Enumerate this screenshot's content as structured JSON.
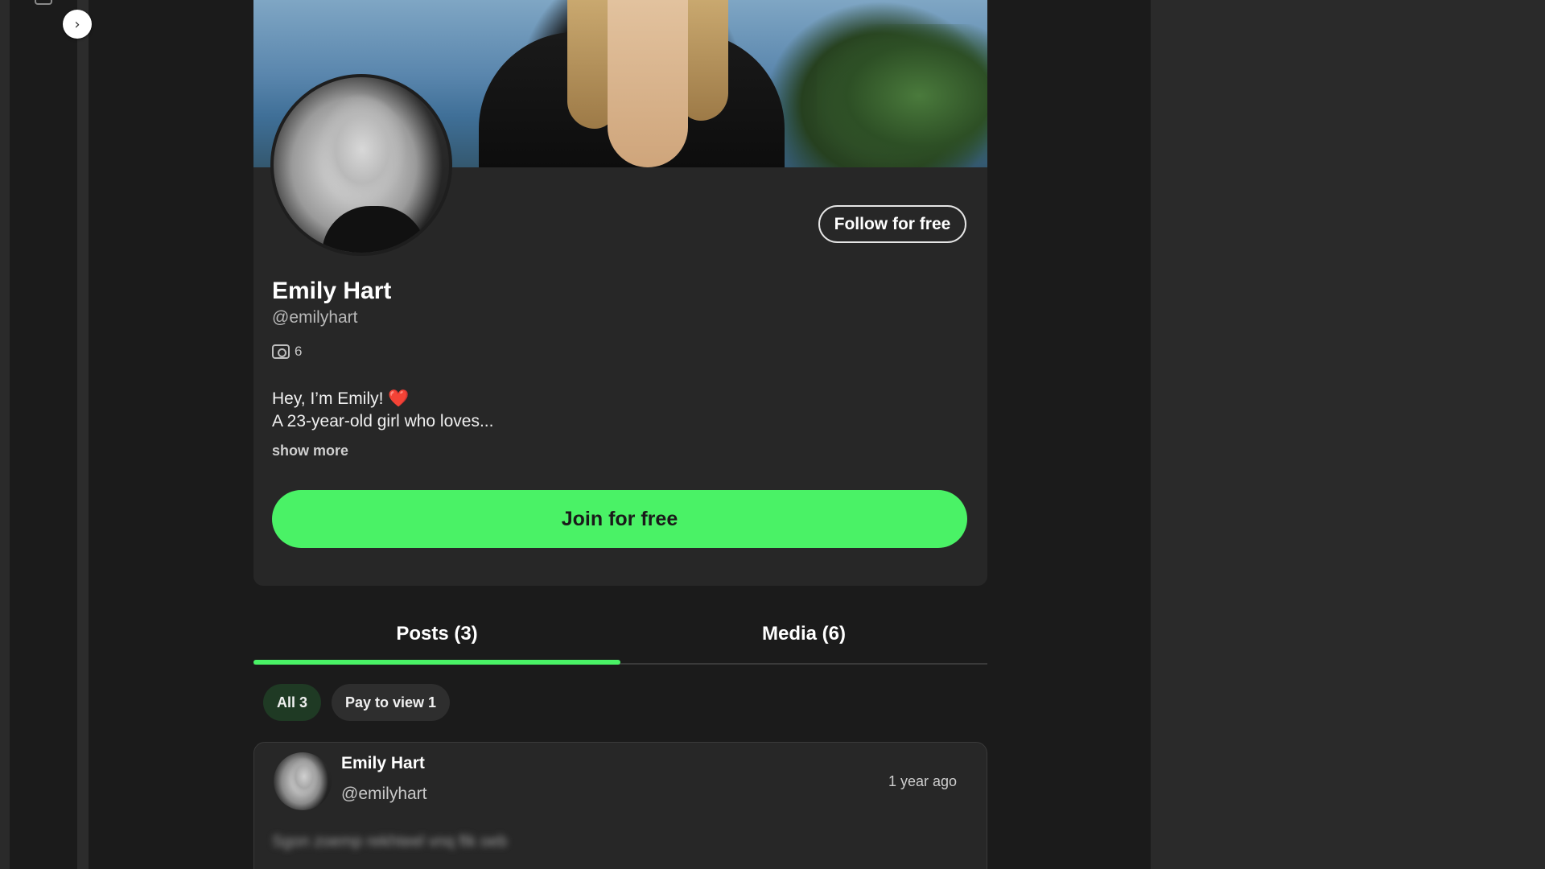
{
  "sidebar": {
    "collapse_icon": "chevron-right-icon",
    "collapse_glyph": "›"
  },
  "profile": {
    "follow_label": "Follow for free",
    "name": "Emily Hart",
    "handle": "@emilyhart",
    "media_count": "6",
    "media_icon": "camera-icon",
    "bio_line1": "Hey, I’m Emily!",
    "bio_heart": "❤️",
    "bio_line2": "A 23-year-old girl who loves...",
    "show_more_label": "show more",
    "join_label": "Join for free",
    "accent_color": "#4af266"
  },
  "tabs": [
    {
      "label": "Posts (3)",
      "active": true
    },
    {
      "label": "Media (6)",
      "active": false
    }
  ],
  "filters": [
    {
      "label": "All 3",
      "active": true
    },
    {
      "label": "Pay to view 1",
      "active": false
    }
  ],
  "post": {
    "author_name": "Emily Hart",
    "author_handle": "@emilyhart",
    "time": "1 year ago",
    "text": "Sgon zoemp rekhteel vnq ftk oeb"
  }
}
